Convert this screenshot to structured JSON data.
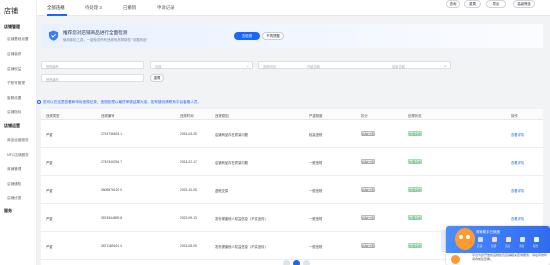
{
  "sidebar": {
    "title": "店铺",
    "groups": [
      {
        "label": "店铺管理",
        "items": [
          "店铺基础设置",
          "店铺装修",
          "店铺权益",
          "子账号管理",
          "客服设置",
          "店铺指标"
        ]
      },
      {
        "label": "店铺运营",
        "items": [
          "商品运营服务",
          "NFC店铺服务",
          "商铺管理",
          "店铺通知",
          "店铺优惠"
        ]
      },
      {
        "label": "服务",
        "items": []
      }
    ]
  },
  "tabs": [
    {
      "label": "全部违规",
      "active": true
    },
    {
      "label": "待处理 3",
      "active": false
    },
    {
      "label": "已撤销",
      "active": false
    },
    {
      "label": "申诉记录",
      "active": false
    }
  ],
  "banner": {
    "title": "推荐您对店铺商品进行全面检测",
    "subtitle": "使用体检工具，一键检查所有违规商品帮助您 “问题商品”",
    "primary_btn": "去检测",
    "secondary_btn": "不再提醒"
  },
  "filters": {
    "fields": [
      {
        "placeholder": "违规编号",
        "dropdown": false
      },
      {
        "placeholder": "全部",
        "dropdown": true
      },
      {
        "placeholder": "违规时间",
        "dropdown": false
      },
      {
        "placeholder": "开始日期",
        "dropdown": false
      },
      {
        "placeholder": "结束日期",
        "dropdown": false
      }
    ],
    "second_row_field": "违规编号",
    "buttons": [
      "查询",
      "重置",
      "导出",
      "高级筛选"
    ],
    "reset_below": "重置"
  },
  "notice": "您可以在这里查看和申诉违规记录，违规处理以最终审核结果为准，如有疑问请联系平台客服人员。",
  "table": {
    "headers": [
      "违规类型",
      "违规编号",
      "违规时间",
      "违规原因",
      "严重程度",
      "扣分",
      "处理状态",
      "操作"
    ],
    "rows": [
      {
        "type": "严重",
        "id": "2743736618 1",
        "time": "2024-03-29",
        "reason": "店铺商品存在质量问题",
        "level": "较高违规",
        "score": "扣除分值",
        "status": "处理完成",
        "action": "查看详情"
      },
      {
        "type": "严重",
        "id": "2742340254 7",
        "time": "2024-02-17",
        "reason": "店铺商品存在质量问题",
        "level": "一般违规",
        "score": "扣除分值",
        "status": "处理完成",
        "action": "查看详情"
      },
      {
        "type": "严重",
        "id": "3605576120 0",
        "time": "2023-10-05",
        "reason": "虚假交易",
        "level": "一般违规",
        "score": "扣除分值",
        "status": "处理完成",
        "action": "查看详情"
      },
      {
        "type": "严重",
        "id": "3574544899 8",
        "time": "2023-09-13",
        "reason": "发布侵害他人权益信息（不实宣传）",
        "level": "一般违规",
        "score": "扣除分值",
        "status": "处理完成",
        "action": "查看详情"
      },
      {
        "type": "严重",
        "id": "3571189104 4",
        "time": "2023-08-09",
        "reason": "发布侵害他人权益信息（不实宣传）",
        "level": "一般违规",
        "score": "扣除分值",
        "status": "处理完成",
        "action": "查看详情"
      }
    ]
  },
  "pager": {
    "pages": [
      "1",
      "2"
    ]
  },
  "helper": {
    "title": "商家助手已就绪",
    "icons": [
      {
        "name": "shop-icon",
        "label": "店铺"
      },
      {
        "name": "coupon-icon",
        "label": "营销"
      },
      {
        "name": "gift-icon",
        "label": "活动"
      },
      {
        "name": "chat-icon",
        "label": "消息"
      },
      {
        "name": "service-icon",
        "label": "服务"
      }
    ],
    "tip": "平台为您开放的违规处罚店铺相关查询服务，请在有效时间内前往查看。",
    "side_text": "助手"
  },
  "colors": {
    "accent": "#1a66ff",
    "success": "#2a9a4a",
    "helper": "#2f6bf0",
    "mascot": "#ff9a2e"
  }
}
